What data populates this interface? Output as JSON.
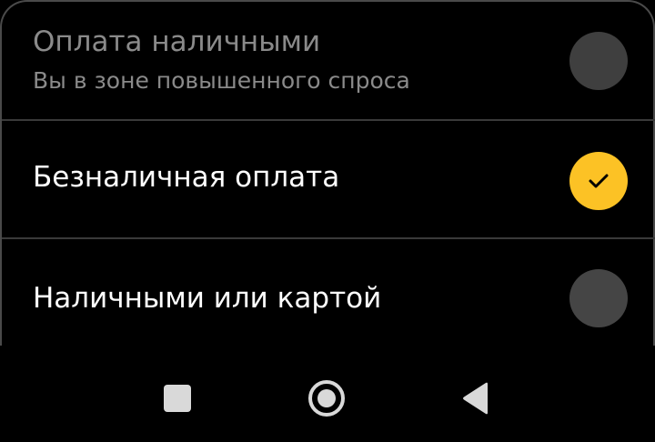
{
  "payment_options": [
    {
      "title": "Оплата наличными",
      "subtitle": "Вы в зоне повышенного спроса",
      "selected": false,
      "enabled": false
    },
    {
      "title": "Безналичная оплата",
      "selected": true,
      "enabled": true
    },
    {
      "title": "Наличными или картой",
      "selected": false,
      "enabled": true
    }
  ],
  "colors": {
    "background": "#000000",
    "accent": "#fcc225",
    "radio_off": "#3f3f3f",
    "divider": "#3a3a3a",
    "text_primary": "#ffffff",
    "text_disabled": "#8a8a8a"
  },
  "icons": {
    "selected_mark": "checkmark-icon",
    "nav_recents": "square-icon",
    "nav_home": "circle-icon",
    "nav_back": "triangle-back-icon"
  }
}
